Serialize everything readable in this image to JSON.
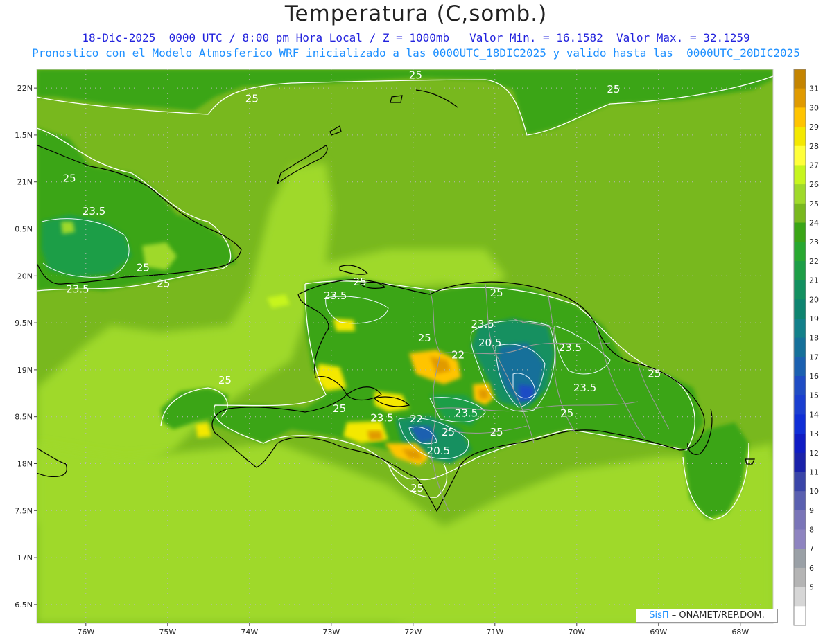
{
  "title": "Temperatura (C,somb.)",
  "subtitle1": "18-Dic-2025  0000 UTC / 8:00 pm Hora Local / Z = 1000mb   Valor Min. = 16.1582  Valor Max. = 32.1259",
  "subtitle2": "Pronostico con el Modelo Atmosferico WRF inicializado a las 0000UTC_18DIC2025 y valido hasta las  0000UTC_20DIC2025",
  "credit": {
    "logo": "SisΠ",
    "text": " – ONAMET/REP.DOM."
  },
  "map": {
    "lon_range": [
      -76.6,
      -67.6
    ],
    "lat_range": [
      16.3,
      22.2
    ],
    "lon_ticks": [
      {
        "value": -76,
        "label": "76W"
      },
      {
        "value": -75,
        "label": "75W"
      },
      {
        "value": -74,
        "label": "74W"
      },
      {
        "value": -73,
        "label": "73W"
      },
      {
        "value": -72,
        "label": "72W"
      },
      {
        "value": -71,
        "label": "71W"
      },
      {
        "value": -70,
        "label": "70W"
      },
      {
        "value": -69,
        "label": "69W"
      },
      {
        "value": -68,
        "label": "68W"
      }
    ],
    "lat_ticks": [
      {
        "value": 22,
        "label": "22N"
      },
      {
        "value": 21.5,
        "label": "1.5N"
      },
      {
        "value": 21,
        "label": "21N"
      },
      {
        "value": 20.5,
        "label": "0.5N"
      },
      {
        "value": 20,
        "label": "20N"
      },
      {
        "value": 19.5,
        "label": "9.5N"
      },
      {
        "value": 19,
        "label": "19N"
      },
      {
        "value": 18.5,
        "label": "8.5N"
      },
      {
        "value": 18,
        "label": "18N"
      },
      {
        "value": 17.5,
        "label": "7.5N"
      },
      {
        "value": 17,
        "label": "17N"
      },
      {
        "value": 16.5,
        "label": "6.5N"
      }
    ],
    "background_color": "#78b81e",
    "contour_labels": [
      {
        "lon": -73.97,
        "lat": 21.85,
        "text": "25"
      },
      {
        "lon": -71.97,
        "lat": 22.1,
        "text": "25"
      },
      {
        "lon": -69.55,
        "lat": 21.95,
        "text": "25"
      },
      {
        "lon": -76.2,
        "lat": 21.0,
        "text": "25"
      },
      {
        "lon": -75.9,
        "lat": 20.65,
        "text": "23.5"
      },
      {
        "lon": -75.3,
        "lat": 20.05,
        "text": "25"
      },
      {
        "lon": -75.05,
        "lat": 19.88,
        "text": "25"
      },
      {
        "lon": -76.1,
        "lat": 19.82,
        "text": "23.5"
      },
      {
        "lon": -72.65,
        "lat": 19.9,
        "text": "25"
      },
      {
        "lon": -72.95,
        "lat": 19.75,
        "text": "23.5"
      },
      {
        "lon": -70.98,
        "lat": 19.78,
        "text": "25"
      },
      {
        "lon": -71.15,
        "lat": 19.45,
        "text": "23.5"
      },
      {
        "lon": -71.86,
        "lat": 19.3,
        "text": "25"
      },
      {
        "lon": -71.06,
        "lat": 19.25,
        "text": "20.5"
      },
      {
        "lon": -71.45,
        "lat": 19.12,
        "text": "22"
      },
      {
        "lon": -70.08,
        "lat": 19.2,
        "text": "23.5"
      },
      {
        "lon": -74.3,
        "lat": 18.85,
        "text": "25"
      },
      {
        "lon": -69.05,
        "lat": 18.92,
        "text": "25"
      },
      {
        "lon": -69.9,
        "lat": 18.77,
        "text": "23.5"
      },
      {
        "lon": -72.9,
        "lat": 18.55,
        "text": "25"
      },
      {
        "lon": -71.35,
        "lat": 18.5,
        "text": "23.5"
      },
      {
        "lon": -70.12,
        "lat": 18.5,
        "text": "25"
      },
      {
        "lon": -72.38,
        "lat": 18.45,
        "text": "23.5"
      },
      {
        "lon": -71.96,
        "lat": 18.44,
        "text": "22"
      },
      {
        "lon": -71.57,
        "lat": 18.3,
        "text": "25"
      },
      {
        "lon": -70.98,
        "lat": 18.3,
        "text": "25"
      },
      {
        "lon": -71.69,
        "lat": 18.1,
        "text": "20.5"
      },
      {
        "lon": -71.95,
        "lat": 17.7,
        "text": "25"
      }
    ]
  },
  "colorbar": {
    "labels": [
      "31",
      "30",
      "29",
      "28",
      "27",
      "26",
      "25",
      "24",
      "23",
      "22",
      "21",
      "20",
      "19",
      "18",
      "17",
      "16",
      "15",
      "14",
      "13",
      "12",
      "11",
      "10",
      "9",
      "8",
      "7",
      "6",
      "5"
    ],
    "colors": [
      "#c48400",
      "#e09a00",
      "#ffc400",
      "#f4e800",
      "#ffff3a",
      "#c7f51e",
      "#9fd92a",
      "#78b81e",
      "#3aa516",
      "#28a830",
      "#1d9e46",
      "#129060",
      "#0e8470",
      "#12808a",
      "#15709a",
      "#1b60b0",
      "#1f4cc4",
      "#1a3ed0",
      "#0f2ed6",
      "#0f1cc4",
      "#1a22aa",
      "#3a45a8",
      "#5a60b0",
      "#7a75b8",
      "#8e84c0",
      "#9aa0a6",
      "#b4b4b4",
      "#d6d6d6",
      "#ffffff"
    ]
  }
}
